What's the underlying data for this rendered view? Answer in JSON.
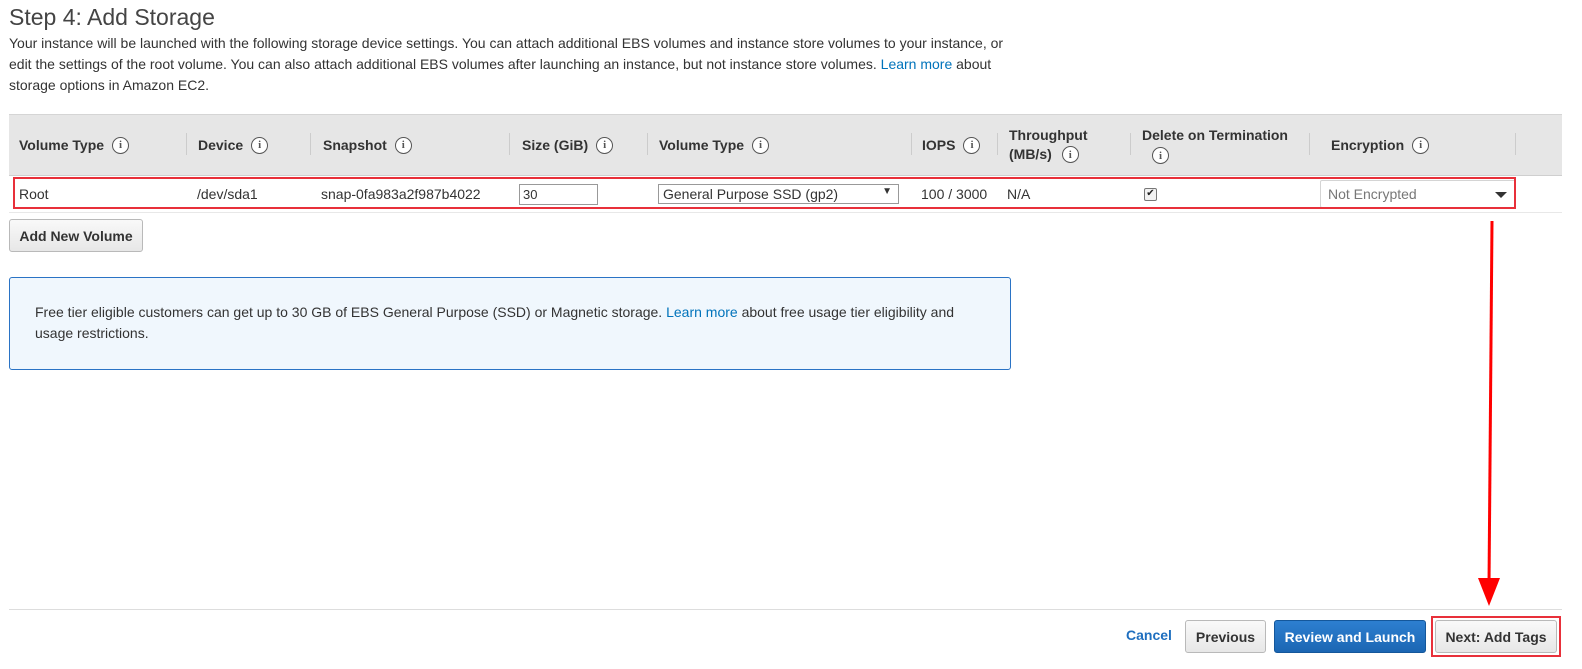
{
  "page": {
    "title": "Step 4: Add Storage",
    "description_before_link": "Your instance will be launched with the following storage device settings. You can attach additional EBS volumes and instance store volumes to your instance, or edit the settings of the root volume. You can also attach additional EBS volumes after launching an instance, but not instance store volumes. ",
    "description_link": "Learn more",
    "description_after_link": " about storage options in Amazon EC2."
  },
  "table": {
    "headers": {
      "volume_type": "Volume Type",
      "device": "Device",
      "snapshot": "Snapshot",
      "size": "Size (GiB)",
      "volume_type2": "Volume Type",
      "iops": "IOPS",
      "throughput_line1": "Throughput",
      "throughput_line2": "(MB/s)",
      "delete_on_termination": "Delete on Termination",
      "encryption": "Encryption"
    },
    "info_icon_glyph": "i",
    "rows": [
      {
        "volume_type": "Root",
        "device": "/dev/sda1",
        "snapshot": "snap-0fa983a2f987b4022",
        "size": "30",
        "volume_type_select": "General Purpose SSD (gp2)",
        "iops": "100 / 3000",
        "throughput": "N/A",
        "delete_on_termination": true,
        "encryption": "Not Encrypted"
      }
    ]
  },
  "buttons": {
    "add_new_volume": "Add New Volume",
    "cancel": "Cancel",
    "previous": "Previous",
    "review_and_launch": "Review and Launch",
    "next": "Next: Add Tags"
  },
  "info_box": {
    "text_before_link": "Free tier eligible customers can get up to 30 GB of EBS General Purpose (SSD) or Magnetic storage. ",
    "link": "Learn more",
    "text_after_link": " about free usage tier eligibility and usage restrictions."
  },
  "glyphs": {
    "select_caret": "▼",
    "checkmark": "✔"
  },
  "colors": {
    "link": "#0073bb",
    "primary_button": "#1b66b3",
    "annotation_red": "#e8303a",
    "info_box_border": "#2a73c5",
    "info_box_bg": "#f0f7fd",
    "header_bg": "#e6e6e6"
  },
  "icons": {
    "info": "info-icon",
    "dropdown": "chevron-down-icon",
    "annotation_arrow": "arrow-down-icon"
  }
}
